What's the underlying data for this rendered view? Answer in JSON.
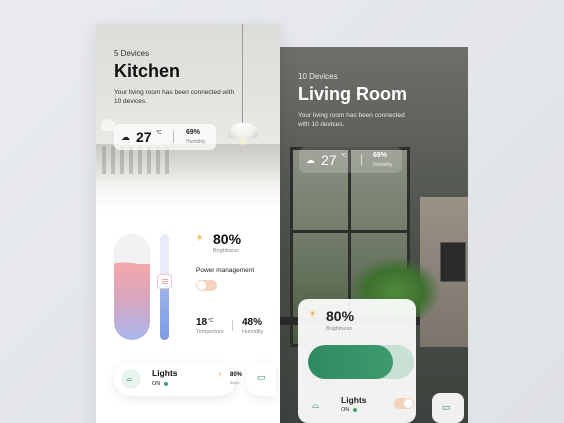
{
  "living_room": {
    "device_count": "10 Devices",
    "title": "Living Room",
    "description": "Your living room has been connected with 10 devices.",
    "weather": {
      "icon": "cloud-icon",
      "temperature": "27",
      "unit": "°C",
      "humidity": "69%",
      "humidity_label": "Humidity"
    },
    "brightness": {
      "icon": "sun-icon",
      "value": "80%",
      "label": "Brightness",
      "level_percent": 80
    },
    "lights": {
      "icon": "lamp-icon",
      "label": "Lights",
      "status": "ON",
      "toggle_on": true
    },
    "side_device": {
      "icon": "air-conditioner-icon"
    }
  },
  "kitchen": {
    "device_count": "5 Devices",
    "title": "Kitchen",
    "description": "Your living room has been connected with 10 devices.",
    "weather": {
      "icon": "cloud-icon",
      "temperature": "27",
      "unit": "°C",
      "humidity": "69%",
      "humidity_label": "Humidity"
    },
    "color_level_percent": 72,
    "slider_level_percent": 55,
    "brightness": {
      "icon": "sun-icon",
      "value": "80%",
      "label": "Brightness"
    },
    "power_management": {
      "label": "Power management",
      "toggle_on": false
    },
    "temperature": {
      "value": "18",
      "unit": "°C",
      "label": "Temporture"
    },
    "humidity": {
      "value": "48%",
      "label": "Humidity"
    },
    "lights": {
      "icon": "lamp-icon",
      "label": "Lights",
      "status": "ON",
      "brightness": "80%",
      "brightness_label": "Bright."
    },
    "side_device": {
      "icon": "air-conditioner-icon"
    }
  },
  "colors": {
    "accent_green": "#2f8a60",
    "status_green": "#3fa36f",
    "toggle_peach": "#f4d3bd",
    "sun_yellow": "#f0b24a"
  }
}
